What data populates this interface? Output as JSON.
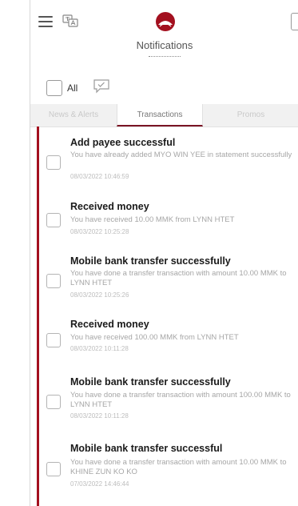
{
  "header": {
    "title": "Notifications",
    "menu_icon": "hamburger-menu-icon",
    "language_icon": "language-translate-icon",
    "logo": "bank-logo",
    "brand_color": "#a3101f"
  },
  "select_all": {
    "label": "All",
    "mark_read_icon": "mark-as-read-icon"
  },
  "tabs": [
    {
      "label": "News & Alerts",
      "active": false
    },
    {
      "label": "Transactions",
      "active": true
    },
    {
      "label": "Promos",
      "active": false
    }
  ],
  "notifications": [
    {
      "title": "Add payee successful",
      "body": "You have already added MYO WIN YEE in statement successfully",
      "time": "08/03/2022 10:46:59"
    },
    {
      "title": "Received money",
      "body": "You have received 10.00 MMK from LYNN HTET",
      "time": "08/03/2022 10:25:28"
    },
    {
      "title": "Mobile bank transfer successfully",
      "body": "You have done a transfer transaction with amount 10.00 MMK to LYNN HTET",
      "time": "08/03/2022 10:25:26"
    },
    {
      "title": "Received money",
      "body": "You have received 100.00 MMK from LYNN HTET",
      "time": "08/03/2022 10:11:28"
    },
    {
      "title": "Mobile bank transfer successfully",
      "body": "You have done a transfer transaction with amount 100.00 MMK to LYNN HTET",
      "time": "08/03/2022 10:11:28"
    },
    {
      "title": "Mobile bank transfer successful",
      "body": "You have done a transfer transaction with amount 10.00 MMK to KHINE ZUN KO KO",
      "time": "07/03/2022 14:46:44"
    }
  ]
}
